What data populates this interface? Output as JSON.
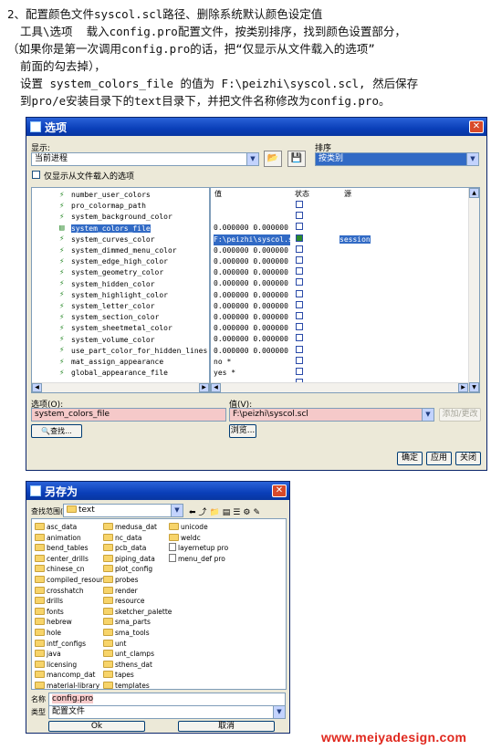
{
  "instructions": {
    "line1": "2、配置颜色文件syscol.scl路径、删除系统默认颜色设定值",
    "line2": "工具\\选项  载入config.pro配置文件，按类别排序，找到颜色设置部分，",
    "line3": "（如果你是第一次调用config.pro的话，把“仅显示从文件载入的选项”",
    "line4": "前面的勾去掉），",
    "line5": "设置 system_colors_file 的值为 F:\\peizhi\\syscol.scl, 然后保存",
    "line6": "到pro/e安装目录下的text目录下，并把文件名称修改为config.pro。"
  },
  "options_dialog": {
    "title": "选项",
    "show_label": "显示:",
    "show_value": "当前进程",
    "sort_label": "排序",
    "sort_value": "按类别",
    "only_loaded_label": "仅显示从文件载入的选项",
    "columns": {
      "name": "",
      "value": "值",
      "status": "状态",
      "source": "源"
    },
    "rows": [
      {
        "name": "number_user_colors",
        "value": "",
        "source": ""
      },
      {
        "name": "pro_colormap_path",
        "value": "",
        "source": ""
      },
      {
        "name": "system_background_color",
        "value": "0.000000 0.000000",
        "source": ""
      },
      {
        "name": "system_colors_file",
        "value": "F:\\peizhi\\syscol.scl",
        "source": "session"
      },
      {
        "name": "system_curves_color",
        "value": "0.000000 0.000000",
        "source": ""
      },
      {
        "name": "system_dimmed_menu_color",
        "value": "0.000000 0.000000",
        "source": ""
      },
      {
        "name": "system_edge_high_color",
        "value": "0.000000 0.000000",
        "source": ""
      },
      {
        "name": "system_geometry_color",
        "value": "0.000000 0.000000",
        "source": ""
      },
      {
        "name": "system_hidden_color",
        "value": "0.000000 0.000000",
        "source": ""
      },
      {
        "name": "system_highlight_color",
        "value": "0.000000 0.000000",
        "source": ""
      },
      {
        "name": "system_letter_color",
        "value": "0.000000 0.000000",
        "source": ""
      },
      {
        "name": "system_section_color",
        "value": "0.000000 0.000000",
        "source": ""
      },
      {
        "name": "system_sheetmetal_color",
        "value": "0.000000 0.000000",
        "source": ""
      },
      {
        "name": "system_volume_color",
        "value": "0.000000 0.000000",
        "source": ""
      },
      {
        "name": "use_part_color_for_hidden_lines",
        "value": "no *",
        "source": ""
      },
      {
        "name": "mat_assign_appearance",
        "value": "yes *",
        "source": ""
      },
      {
        "name": "global_appearance_file",
        "value": "",
        "source": ""
      }
    ],
    "option_label": "选项(O):",
    "option_value": "system_colors_file",
    "value_label": "值(V):",
    "value_value": "F:\\peizhi\\syscol.scl",
    "add_change_button": "添加/更改",
    "find_button": "查找...",
    "browse_button": "浏览...",
    "ok_button": "确定",
    "apply_button": "应用",
    "close_button": "关闭"
  },
  "saveas_dialog": {
    "title": "另存为",
    "lookin_label": "查找范围(I):",
    "lookin_value": "text",
    "files": [
      [
        "asc_data",
        "medusa_dat",
        "unicode"
      ],
      [
        "animation",
        "nc_data",
        "weldc"
      ],
      [
        "bend_tables",
        "pcb_data",
        "layernetup pro"
      ],
      [
        "center_drills",
        "piping_data",
        "menu_def pro"
      ],
      [
        "chinese_cn",
        "plot_config",
        ""
      ],
      [
        "compiled_resource",
        "probes",
        ""
      ],
      [
        "crosshatch",
        "render",
        ""
      ],
      [
        "drills",
        "resource",
        ""
      ],
      [
        "fonts",
        "sketcher_palette",
        ""
      ],
      [
        "hebrew",
        "sma_parts",
        ""
      ],
      [
        "hole",
        "sma_tools",
        ""
      ],
      [
        "intf_configs",
        "unt",
        ""
      ],
      [
        "java",
        "unt_clamps",
        ""
      ],
      [
        "licensing",
        "sthens_dat",
        ""
      ],
      [
        "mancomp_dat",
        "tapes",
        ""
      ],
      [
        "material-library",
        "templates",
        ""
      ]
    ],
    "filename_label": "名称",
    "filename_value": "config.pro",
    "type_label": "类型",
    "type_value": "配置文件",
    "ok_button": "Ok",
    "cancel_button": "取消"
  },
  "watermark": "www.meiyadesign.com"
}
